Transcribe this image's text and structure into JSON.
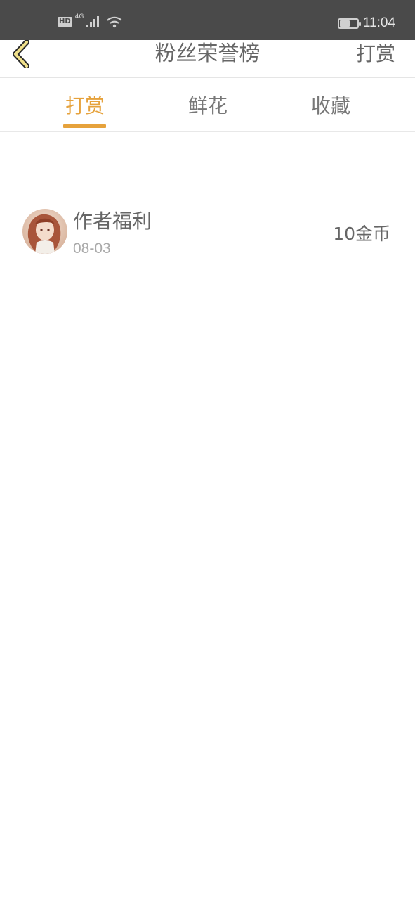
{
  "status_bar": {
    "hd_badge": "HD",
    "network_type": "4G",
    "time": "11:04",
    "battery_level": 0.6,
    "icons": [
      "hd-icon",
      "signal-icon",
      "wifi-icon",
      "battery-icon"
    ]
  },
  "header": {
    "back_icon": "chevron-left-icon",
    "title": "粉丝荣誉榜",
    "reward_link": "打赏"
  },
  "tabs": [
    {
      "label": "打赏",
      "active": true
    },
    {
      "label": "鲜花",
      "active": false
    },
    {
      "label": "收藏",
      "active": false
    }
  ],
  "list": [
    {
      "name": "作者福利",
      "date": "08-03",
      "amount": "10金币",
      "avatar_icon": "user-avatar"
    }
  ],
  "colors": {
    "accent": "#e6a23c",
    "status_bar_bg": "#4a4a4a",
    "text": "#666666",
    "subtext": "#aaaaaa",
    "back_icon_fill": "#f0e08a"
  }
}
